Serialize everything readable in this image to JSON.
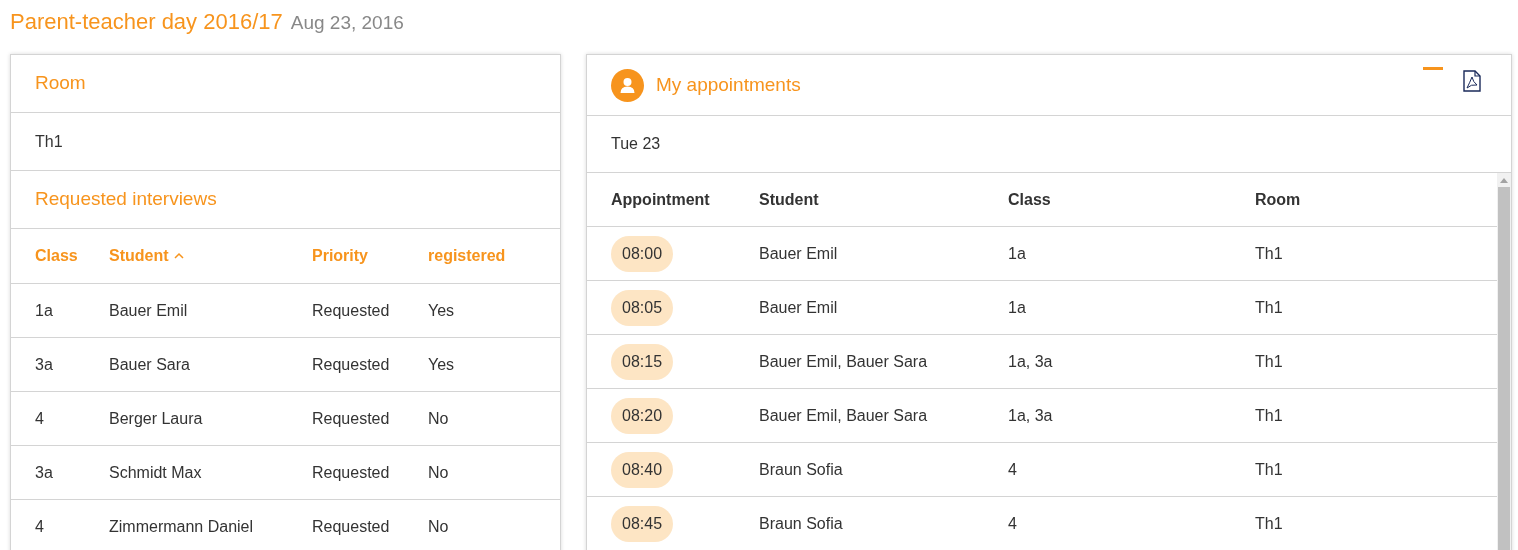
{
  "page_title": {
    "title": "Parent-teacher day 2016/17",
    "date": "Aug 23, 2016"
  },
  "room_panel": {
    "title": "Room",
    "value": "Th1"
  },
  "requests": {
    "title": "Requested interviews",
    "columns": [
      {
        "label": "Class",
        "sorted": false
      },
      {
        "label": "Student",
        "sorted": true
      },
      {
        "label": "Priority",
        "sorted": false
      },
      {
        "label": "registered",
        "sorted": false
      }
    ],
    "rows": [
      {
        "cells": [
          "1a",
          "Bauer Emil",
          "Requested",
          "Yes"
        ]
      },
      {
        "cells": [
          "3a",
          "Bauer Sara",
          "Requested",
          "Yes"
        ]
      },
      {
        "cells": [
          "4",
          "Berger Laura",
          "Requested",
          "No"
        ]
      },
      {
        "cells": [
          "3a",
          "Schmidt Max",
          "Requested",
          "No"
        ]
      },
      {
        "cells": [
          "4",
          "Zimmermann Daniel",
          "Requested",
          "No"
        ]
      }
    ]
  },
  "appointments": {
    "title": "My appointments",
    "day": "Tue 23",
    "columns": [
      "Appointment",
      "Student",
      "Class",
      "Room"
    ],
    "rows": [
      {
        "time": "08:00",
        "student": "Bauer Emil",
        "class": "1a",
        "room": "Th1"
      },
      {
        "time": "08:05",
        "student": "Bauer Emil",
        "class": "1a",
        "room": "Th1"
      },
      {
        "time": "08:15",
        "student": "Bauer Emil, Bauer Sara",
        "class": "1a, 3a",
        "room": "Th1"
      },
      {
        "time": "08:20",
        "student": "Bauer Emil, Bauer Sara",
        "class": "1a, 3a",
        "room": "Th1"
      },
      {
        "time": "08:40",
        "student": "Braun Sofia",
        "class": "4",
        "room": "Th1"
      },
      {
        "time": "08:45",
        "student": "Braun Sofia",
        "class": "4",
        "room": "Th1"
      }
    ]
  }
}
